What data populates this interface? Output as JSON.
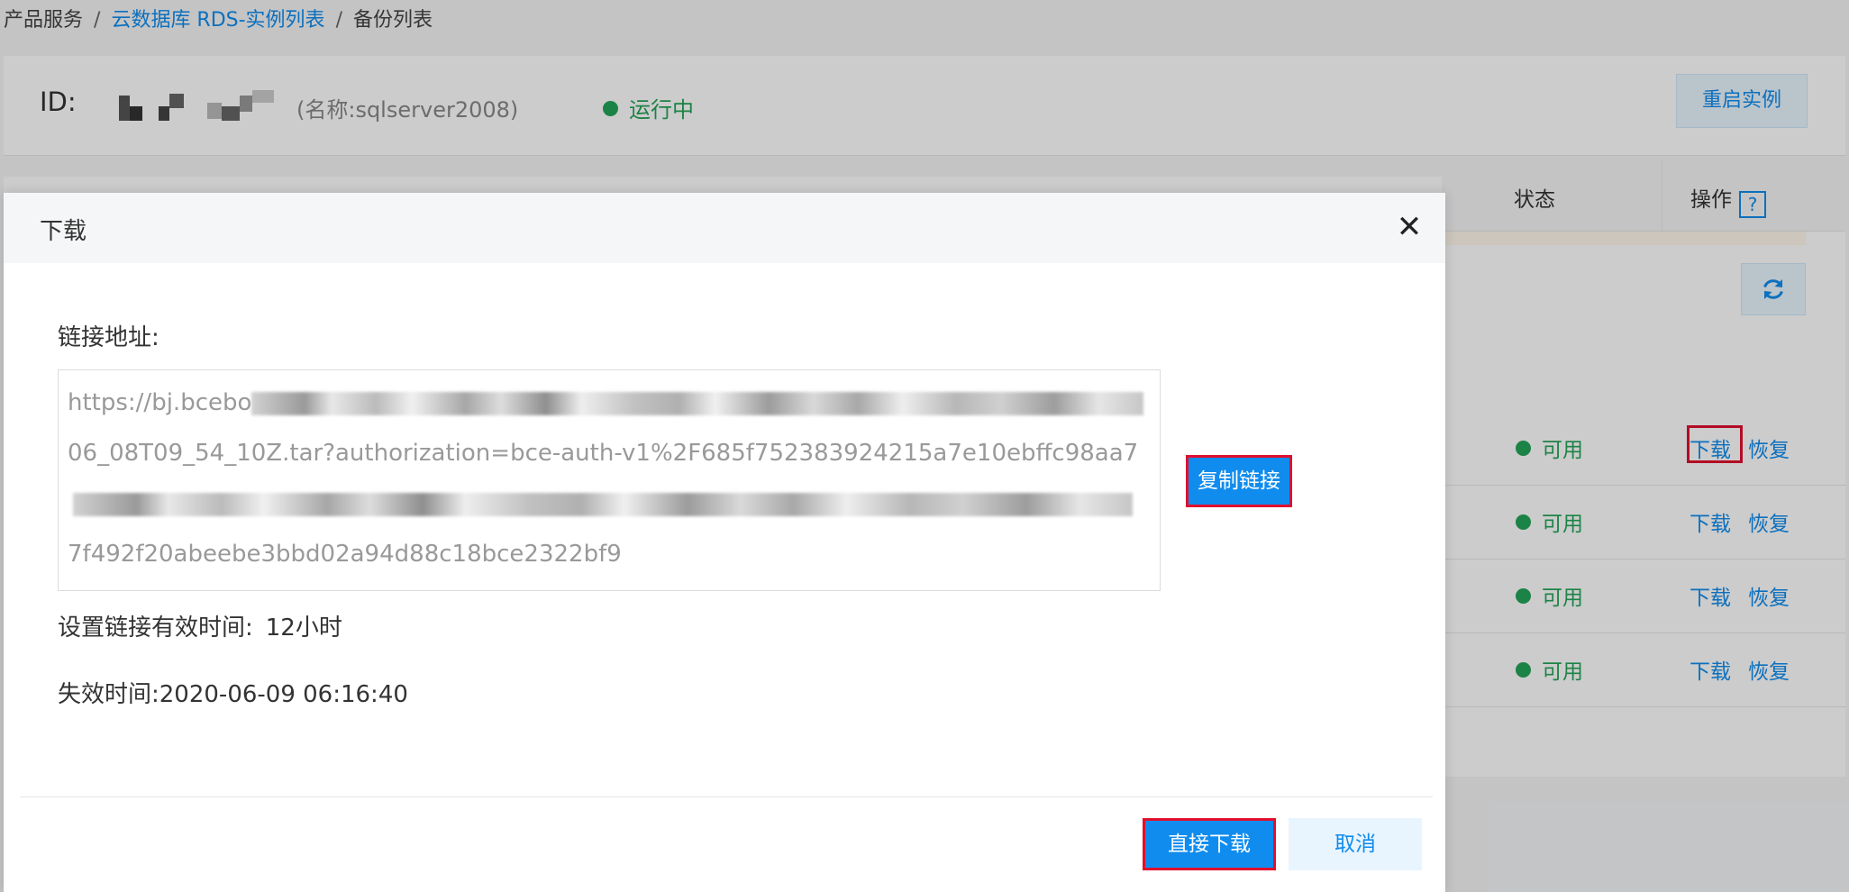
{
  "breadcrumb": {
    "items": [
      "产品服务",
      "云数据库 RDS-实例列表",
      "备份列表"
    ],
    "separator": "/"
  },
  "instance": {
    "id_label": "ID:",
    "name_text": "(名称:sqlserver2008)",
    "status_text": "运行中",
    "restart_label": "重启实例"
  },
  "table": {
    "headers": {
      "status": "状态",
      "actions": "操作",
      "help": "?"
    },
    "rows": [
      {
        "status": "可用",
        "download": "下载",
        "restore": "恢复"
      },
      {
        "status": "可用",
        "download": "下载",
        "restore": "恢复"
      },
      {
        "status": "可用",
        "download": "下载",
        "restore": "恢复"
      },
      {
        "status": "可用",
        "download": "下载",
        "restore": "恢复"
      }
    ]
  },
  "dialog": {
    "title": "下载",
    "close_symbol": "✕",
    "link_label": "链接地址:",
    "link_lines": [
      "https://bj.bcebo",
      "06_08T09_54_10Z.tar?authorization=bce-auth-v1%2F685f752383924215a7e10ebffc98aa7",
      "",
      "7f492f20abeebe3bbd02a94d88c18bce2322bf9"
    ],
    "copy_link_label": "复制链接",
    "expiry_label": "设置链接有效时间:",
    "expiry_value": "12小时",
    "expire_time_label": "失效时间:",
    "expire_time_value": "2020-06-09 06:16:40",
    "direct_download_label": "直接下载",
    "cancel_label": "取消"
  },
  "colors": {
    "accent": "#108cee",
    "success": "#23a458",
    "highlight": "#e0102e"
  }
}
